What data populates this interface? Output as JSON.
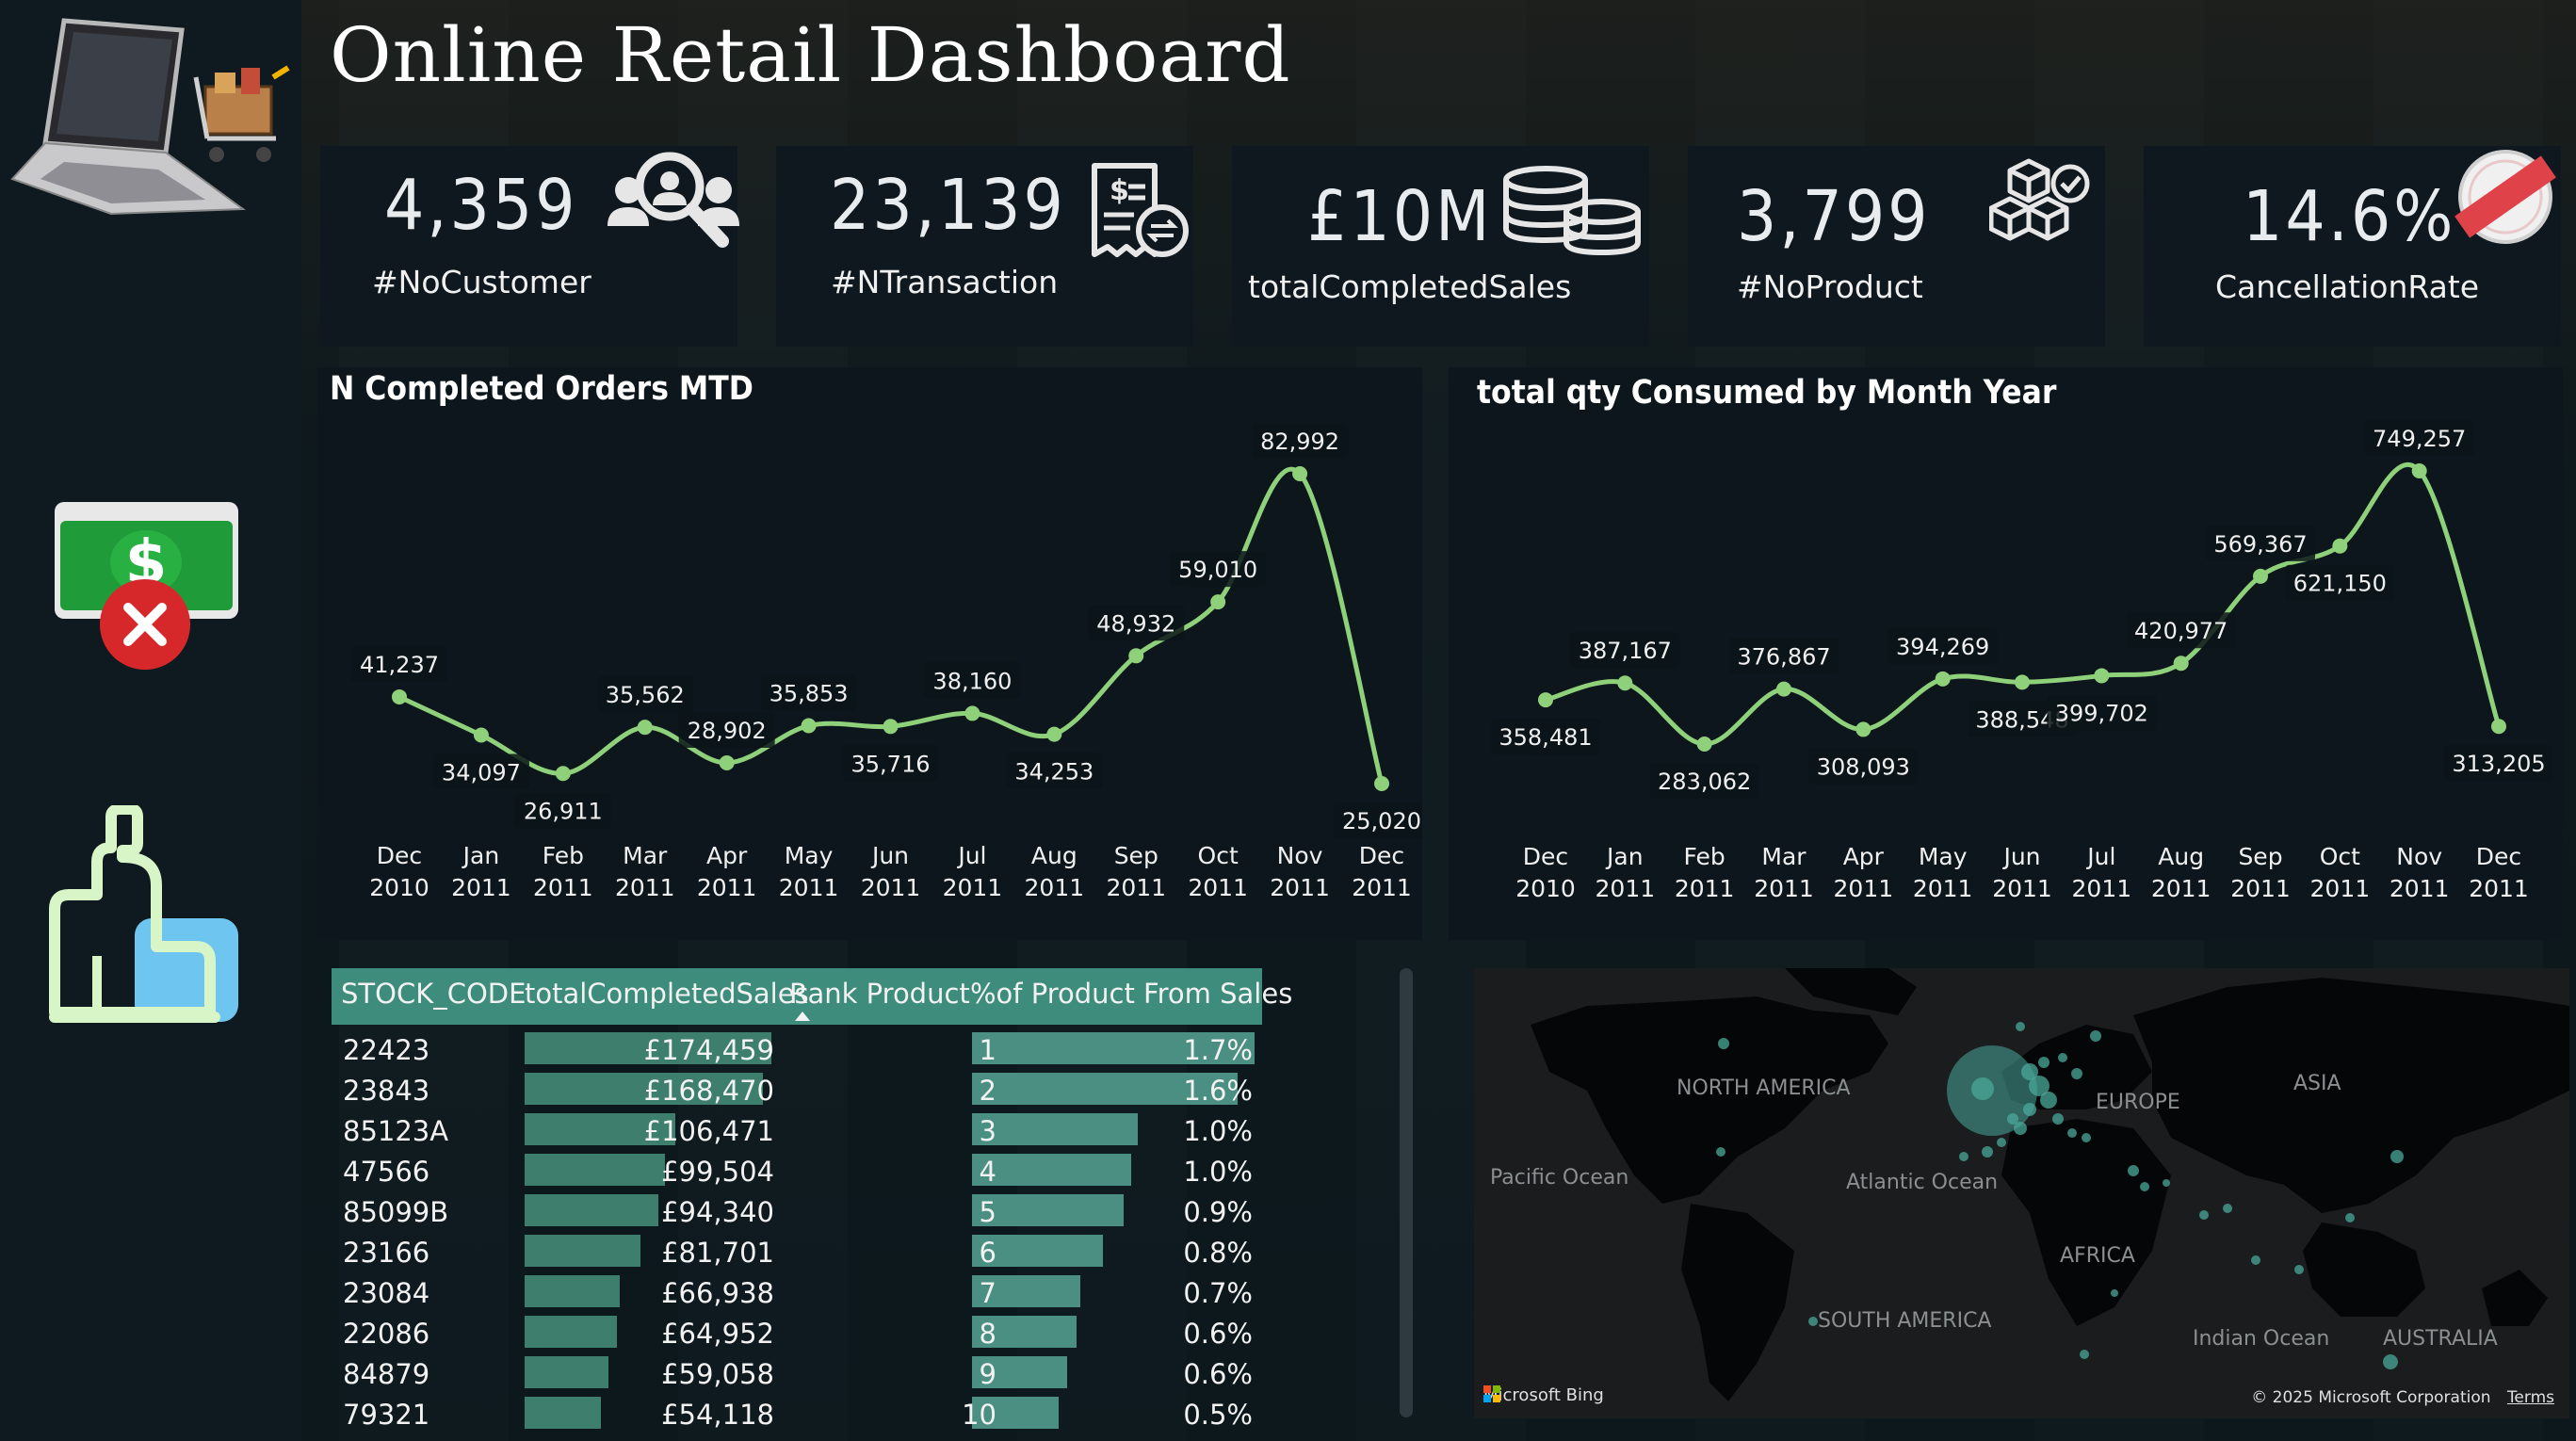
{
  "title": "Online Retail Dashboard",
  "kpis": [
    {
      "value": "4,359",
      "label": "#NoCustomer",
      "icon": "customer-search-icon"
    },
    {
      "value": "23,139",
      "label": "#NTransaction",
      "icon": "receipt-icon"
    },
    {
      "value": "£10M",
      "label": "totalCompletedSales",
      "icon": "coins-icon"
    },
    {
      "value": "3,799",
      "label": "#NoProduct",
      "icon": "boxes-icon"
    },
    {
      "value": "14.6%",
      "label": "CancellationRate",
      "icon": "cancelled-stamp-icon"
    }
  ],
  "sidebar": {
    "icons": [
      "laptop-cart-icon",
      "money-cancel-icon",
      "ranking-chart-icon"
    ]
  },
  "colors": {
    "line": "#8fd07a",
    "table_header": "#3e8c7c",
    "bar": "#3d7f6c"
  },
  "chart_data": [
    {
      "type": "line",
      "title": "N Completed Orders MTD",
      "x_month": [
        "Dec",
        "Jan",
        "Feb",
        "Mar",
        "Apr",
        "May",
        "Jun",
        "Jul",
        "Aug",
        "Sep",
        "Oct",
        "Nov",
        "Dec"
      ],
      "x_year": [
        "2010",
        "2011",
        "2011",
        "2011",
        "2011",
        "2011",
        "2011",
        "2011",
        "2011",
        "2011",
        "2011",
        "2011",
        "2011"
      ],
      "values": [
        41237,
        34097,
        26911,
        35562,
        28902,
        35853,
        35716,
        38160,
        34253,
        48932,
        59010,
        82992,
        25020
      ],
      "labels": [
        "41,237",
        "34,097",
        "26,911",
        "35,562",
        "28,902",
        "35,853",
        "35,716",
        "38,160",
        "34,253",
        "48,932",
        "59,010",
        "82,992",
        "25,020"
      ]
    },
    {
      "type": "line",
      "title": "total qty Consumed by Month Year",
      "x_month": [
        "Dec",
        "Jan",
        "Feb",
        "Mar",
        "Apr",
        "May",
        "Jun",
        "Jul",
        "Aug",
        "Sep",
        "Oct",
        "Nov",
        "Dec"
      ],
      "x_year": [
        "2010",
        "2011",
        "2011",
        "2011",
        "2011",
        "2011",
        "2011",
        "2011",
        "2011",
        "2011",
        "2011",
        "2011",
        "2011"
      ],
      "values": [
        358481,
        387167,
        283062,
        376867,
        308093,
        394269,
        388548,
        399702,
        420977,
        569367,
        621150,
        749257,
        313205
      ],
      "labels": [
        "358,481",
        "387,167",
        "283,062",
        "376,867",
        "308,093",
        "394,269",
        "388,548",
        "399,702",
        "420,977",
        "569,367",
        "621,150",
        "749,257",
        "313,205"
      ]
    }
  ],
  "table": {
    "headers": [
      "STOCK_CODE",
      "totalCompletedSales",
      "Rank Product",
      "%of Product From Sales"
    ],
    "rows": [
      {
        "code": "22423",
        "sales": "£174,459",
        "sales_value": 174459,
        "rank": "1",
        "pct": "1.7%",
        "pct_value": 1.7
      },
      {
        "code": "23843",
        "sales": "£168,470",
        "sales_value": 168470,
        "rank": "2",
        "pct": "1.6%",
        "pct_value": 1.6
      },
      {
        "code": "85123A",
        "sales": "£106,471",
        "sales_value": 106471,
        "rank": "3",
        "pct": "1.0%",
        "pct_value": 1.0
      },
      {
        "code": "47566",
        "sales": "£99,504",
        "sales_value": 99504,
        "rank": "4",
        "pct": "1.0%",
        "pct_value": 0.96
      },
      {
        "code": "85099B",
        "sales": "£94,340",
        "sales_value": 94340,
        "rank": "5",
        "pct": "0.9%",
        "pct_value": 0.91
      },
      {
        "code": "23166",
        "sales": "£81,701",
        "sales_value": 81701,
        "rank": "6",
        "pct": "0.8%",
        "pct_value": 0.79
      },
      {
        "code": "23084",
        "sales": "£66,938",
        "sales_value": 66938,
        "rank": "7",
        "pct": "0.7%",
        "pct_value": 0.65
      },
      {
        "code": "22086",
        "sales": "£64,952",
        "sales_value": 64952,
        "rank": "8",
        "pct": "0.6%",
        "pct_value": 0.63
      },
      {
        "code": "84879",
        "sales": "£59,058",
        "sales_value": 59058,
        "rank": "9",
        "pct": "0.6%",
        "pct_value": 0.57
      },
      {
        "code": "79321",
        "sales": "£54,118",
        "sales_value": 54118,
        "rank": "10",
        "pct": "0.5%",
        "pct_value": 0.52
      }
    ]
  },
  "map": {
    "labels": [
      "NORTH AMERICA",
      "EUROPE",
      "ASIA",
      "Pacific Ocean",
      "Atlantic Ocean",
      "AFRICA",
      "SOUTH AMERICA",
      "Indian Ocean",
      "AUSTRALIA"
    ],
    "attribution": "Microsoft Bing",
    "copyright": "© 2025 Microsoft Corporation",
    "terms": "Terms"
  }
}
